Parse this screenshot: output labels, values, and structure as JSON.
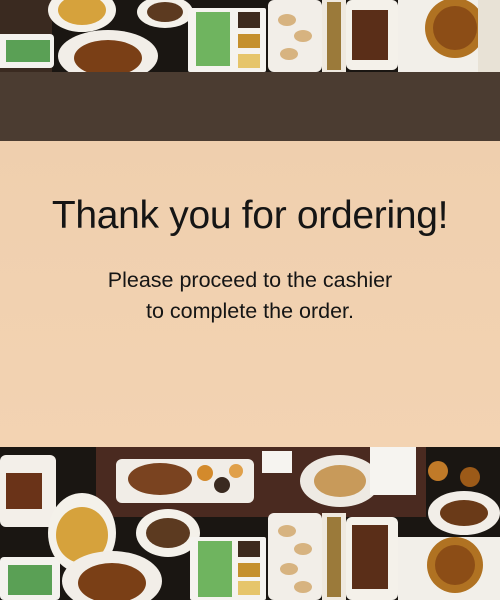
{
  "screen": {
    "title": "Thank you for ordering!",
    "message_line1": "Please proceed to the cashier",
    "message_line2": "to complete the order."
  },
  "colors": {
    "panel": "#f1d1b0",
    "band": "#4b3c31",
    "text": "#151515"
  },
  "images": {
    "top": "food-photo-collage",
    "bottom": "food-photo-collage"
  }
}
